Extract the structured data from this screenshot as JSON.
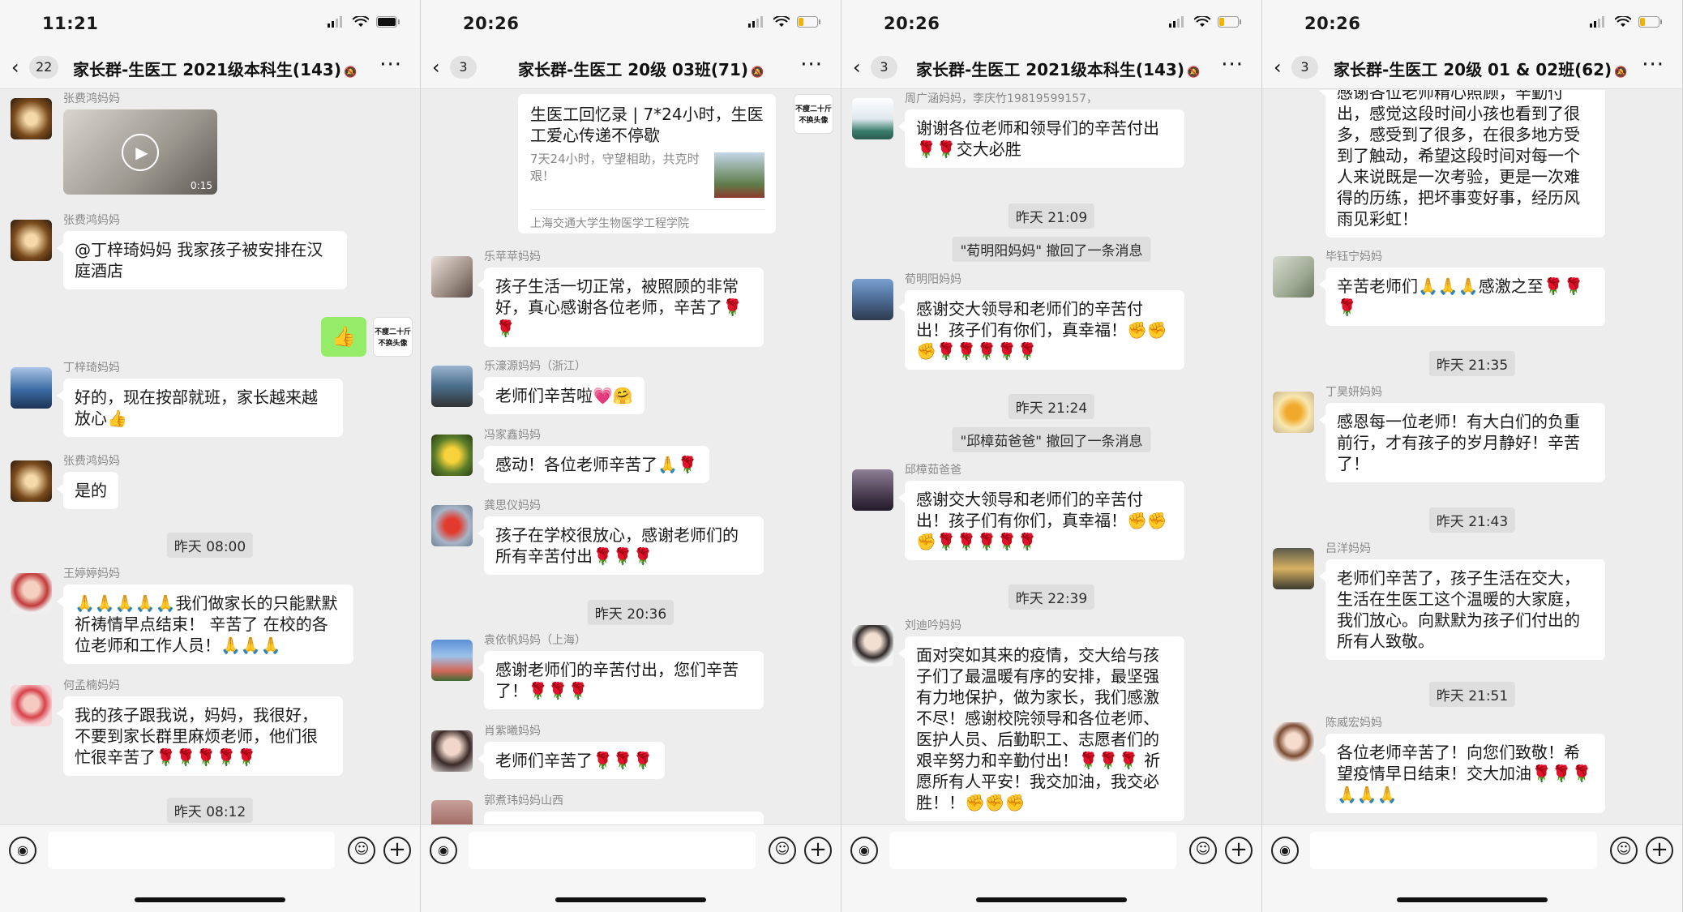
{
  "panels": [
    {
      "status_time": "11:21",
      "badge": "22",
      "title": "家长群-生医工 2021级本科生(143)",
      "messages": [
        {
          "sender": "张费鸿妈妈",
          "video_duration": "0:15"
        },
        {
          "sender": "张费鸿妈妈",
          "text": "@丁梓琦妈妈 我家孩子被安排在汉庭酒店"
        },
        {
          "self": true,
          "self_avatar_text": "不瘦二十斤 不换头像",
          "emoji": "👍"
        },
        {
          "sender": "丁梓琦妈妈",
          "text": "好的，现在按部就班，家长越来越放心👍"
        },
        {
          "sender": "张费鸿妈妈",
          "text": "是的"
        },
        {
          "timestamp": "昨天 08:00"
        },
        {
          "sender": "王婷婷妈妈",
          "text": "🙏🙏🙏🙏🙏我们做家长的只能默默祈祷情早点结束！ 辛苦了 在校的各位老师和工作人员！🙏🙏🙏"
        },
        {
          "sender": "何孟楠妈妈",
          "text": "我的孩子跟我说，妈妈，我很好，不要到家长群里麻烦老师，他们很忙很辛苦了🌹🌹🌹🌹🌹"
        },
        {
          "timestamp": "昨天 08:12"
        }
      ]
    },
    {
      "status_time": "20:26",
      "badge": "3",
      "title": "家长群-生医工 20级 03班(71)",
      "messages": [
        {
          "card_title": "生医工回忆录 | 7*24小时，生医工爱心传递不停歇",
          "card_desc": "7天24小时，守望相助，共克时艰！",
          "card_source": "上海交通大学生物医学工程学院",
          "self_avatar_text": "不瘦二十斤 不换头像"
        },
        {
          "sender": "乐苹苹妈妈",
          "text": "孩子生活一切正常，被照顾的非常好，真心感谢各位老师，辛苦了🌹🌹"
        },
        {
          "sender": "乐濠源妈妈（浙江）",
          "text": "老师们辛苦啦💗🤗"
        },
        {
          "sender": "冯家鑫妈妈",
          "text": "感动！各位老师辛苦了🙏🌹"
        },
        {
          "sender": "龚思仪妈妈",
          "text": "孩子在学校很放心，感谢老师们的所有辛苦付出🌹🌹🌹"
        },
        {
          "timestamp": "昨天 20:36"
        },
        {
          "sender": "袁依帆妈妈（上海）",
          "text": "感谢老师们的辛苦付出，您们辛苦了！🌹🌹🌹"
        },
        {
          "sender": "肖紫曦妈妈",
          "text": "老师们辛苦了🌹🌹🌹"
        },
        {
          "sender": "郭煮玮妈妈山西",
          "text": ""
        }
      ]
    },
    {
      "status_time": "20:26",
      "badge": "3",
      "title": "家长群-生医工 2021级本科生(143)",
      "messages": [
        {
          "sender": "周广涵妈妈，李庆竹19819599157，",
          "text": "谢谢各位老师和领导们的辛苦付出🌹🌹交大必胜"
        },
        {
          "timestamp": "昨天 21:09"
        },
        {
          "system": "\"荀明阳妈妈\" 撤回了一条消息"
        },
        {
          "sender": "荀明阳妈妈",
          "text": "感谢交大领导和老师们的辛苦付出！孩子们有你们，真幸福！✊✊✊🌹🌹🌹🌹🌹"
        },
        {
          "timestamp": "昨天 21:24"
        },
        {
          "system": "\"邱樟茹爸爸\" 撤回了一条消息"
        },
        {
          "sender": "邱樟茹爸爸",
          "text": "感谢交大领导和老师们的辛苦付出！孩子们有你们，真幸福！✊✊✊🌹🌹🌹🌹🌹"
        },
        {
          "timestamp": "昨天 22:39"
        },
        {
          "sender": "刘迪吟妈妈",
          "text": "面对突如其来的疫情，交大给与孩子们了最温暖有序的安排，最坚强有力地保护，做为家长，我们感激不尽！感谢校院领导和各位老师、医护人员、后勤职工、志愿者们的艰辛努力和辛勤付出！🌹🌹🌹      祈愿所有人平安！我交加油，我交必胜！！✊✊✊"
        }
      ]
    },
    {
      "status_time": "20:26",
      "badge": "3",
      "title": "家长群-生医工 20级 01 & 02班(62)",
      "messages": [
        {
          "sender": "",
          "text": "感谢各位老师精心照顾，辛勤付出，感觉这段时间小孩也看到了很多，感受到了很多，在很多地方受到了触动，希望这段时间对每一个人来说既是一次考验，更是一次难得的历练，把坏事变好事，经历风雨见彩虹！"
        },
        {
          "sender": "毕钰宁妈妈",
          "text": "辛苦老师们🙏🙏🙏感激之至🌹🌹🌹"
        },
        {
          "timestamp": "昨天 21:35"
        },
        {
          "sender": "丁昊妍妈妈",
          "text": "感恩每一位老师！有大白们的负重前行，才有孩子的岁月静好！辛苦了！"
        },
        {
          "timestamp": "昨天 21:43"
        },
        {
          "sender": "吕洋妈妈",
          "text": "老师们辛苦了，孩子生活在交大，生活在生医工这个温暖的大家庭，我们放心。向默默为孩子们付出的所有人致敬。"
        },
        {
          "timestamp": "昨天 21:51"
        },
        {
          "sender": "陈威宏妈妈",
          "text": "各位老师辛苦了！向您们致敬！希望疫情早日结束！交大加油🌹🌹🌹🙏🙏🙏"
        }
      ]
    }
  ],
  "icons": {
    "back": "chevron-left-icon",
    "more": "more-icon",
    "mute": "mute-bell-icon",
    "voice": "voice-icon",
    "emoji": "emoji-icon",
    "plus": "plus-icon",
    "signal": "signal-icon",
    "wifi": "wifi-icon",
    "battery": "battery-icon"
  },
  "colors": {
    "chat_bg": "#ededed",
    "bubble": "#ffffff",
    "self_bubble": "#95ec69",
    "timestamp_bg": "#dedede"
  }
}
